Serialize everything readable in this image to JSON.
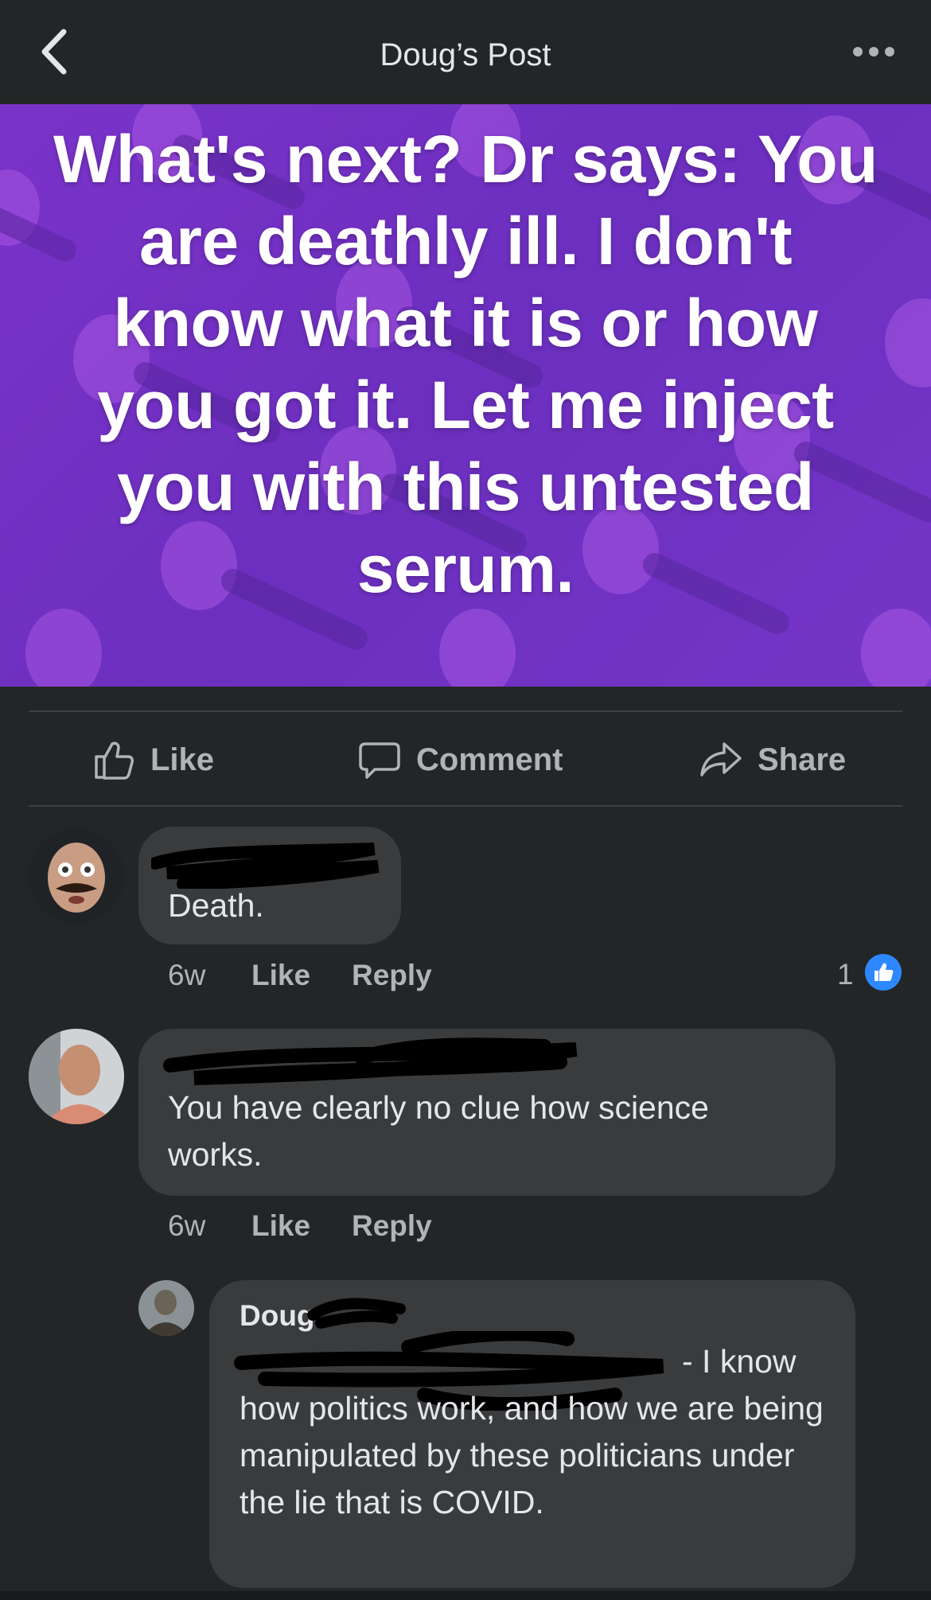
{
  "header": {
    "title": "Doug’s Post"
  },
  "post": {
    "image_text": "What's next? Dr says: You are deathly ill. I don't know what it is or how you got it. Let me inject you with this untested serum.",
    "background_color": "#7433c7"
  },
  "actions": {
    "like": "Like",
    "comment": "Comment",
    "share": "Share"
  },
  "comments": [
    {
      "text": "Death.",
      "time": "6w",
      "like": "Like",
      "reply": "Reply",
      "reaction_count": "1"
    },
    {
      "text": "You have clearly no clue how science works.",
      "time": "6w",
      "like": "Like",
      "reply": "Reply"
    }
  ],
  "reply": {
    "author": "Doug",
    "text": "- I know how politics work, and how we are being manipulated by these politicians under the lie that is COVID."
  },
  "colors": {
    "background": "#242526",
    "bubble": "#3a3b3c",
    "like_blue": "#2d88ff",
    "muted_text": "#b0b3b8"
  }
}
